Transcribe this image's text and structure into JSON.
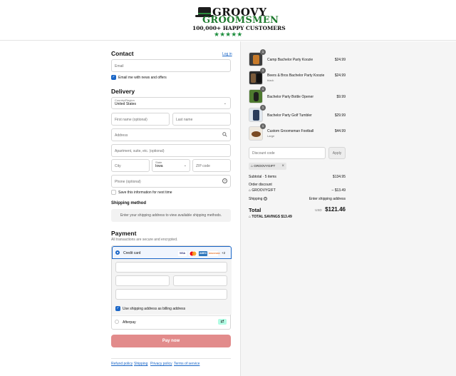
{
  "brand": {
    "line1": "GROOVY",
    "line2": "GROOMSMEN",
    "tagline": "100,000+ HAPPY CUSTOMERS",
    "stars": "★★★★★",
    "accent": "#1e8e3e"
  },
  "contact": {
    "heading": "Contact",
    "login_link": "Log in",
    "email_placeholder": "Email",
    "email_opt_in": "Email me with news and offers"
  },
  "delivery": {
    "heading": "Delivery",
    "country_label": "Country/Region",
    "country_value": "United States",
    "first_name": "First name (optional)",
    "last_name": "Last name",
    "address": "Address",
    "apartment": "Apartment, suite, etc. (optional)",
    "city": "City",
    "state_label": "State",
    "state_value": "Iowa",
    "zip": "ZIP code",
    "phone": "Phone (optional)",
    "save_info": "Save this information for next time"
  },
  "shipping": {
    "heading": "Shipping method",
    "message": "Enter your shipping address to view available shipping methods."
  },
  "payment": {
    "heading": "Payment",
    "subtitle": "All transactions are secure and encrypted.",
    "credit_card": "Credit card",
    "brands": [
      "VISA",
      "MC",
      "AMEX",
      "DISCOVER"
    ],
    "more": "+2",
    "billing_same": "Use shipping address as billing address",
    "afterpay": "Afterpay",
    "pay_button": "Pay now",
    "pay_color": "#e28b8b"
  },
  "footer": {
    "links": [
      "Refund policy",
      "Shipping",
      "Privacy policy",
      "Terms of service"
    ]
  },
  "cart": {
    "items": [
      {
        "qty": "1",
        "name": "Camp Bachelor Party Koozie",
        "variant": "",
        "price": "$24.99"
      },
      {
        "qty": "1",
        "name": "Beers & Bros Bachelor Party Koozie",
        "variant": "black",
        "price": "$24.99"
      },
      {
        "qty": "1",
        "name": "Bachelor Party Bottle Opener",
        "variant": "",
        "price": "$9.99"
      },
      {
        "qty": "1",
        "name": "Bachelor Party Golf Tumbler",
        "variant": "",
        "price": "$29.99"
      },
      {
        "qty": "1",
        "name": "Custom Groomsman Football",
        "variant": "Large",
        "price": "$44.99"
      }
    ],
    "discount_placeholder": "Discount code",
    "apply": "Apply",
    "applied_code": "GROOVYGIFT",
    "subtotal_label": "Subtotal · 5 items",
    "subtotal_value": "$134.95",
    "order_discount_label": "Order discount",
    "order_discount_code": "GROOVYGIFT",
    "order_discount_value": "– $13.49",
    "shipping_label": "Shipping",
    "shipping_value": "Enter shipping address",
    "total_label": "Total",
    "currency": "USD",
    "total_value": "$121.46",
    "savings_label": "TOTAL SAVINGS",
    "savings_value": "$13.49"
  }
}
